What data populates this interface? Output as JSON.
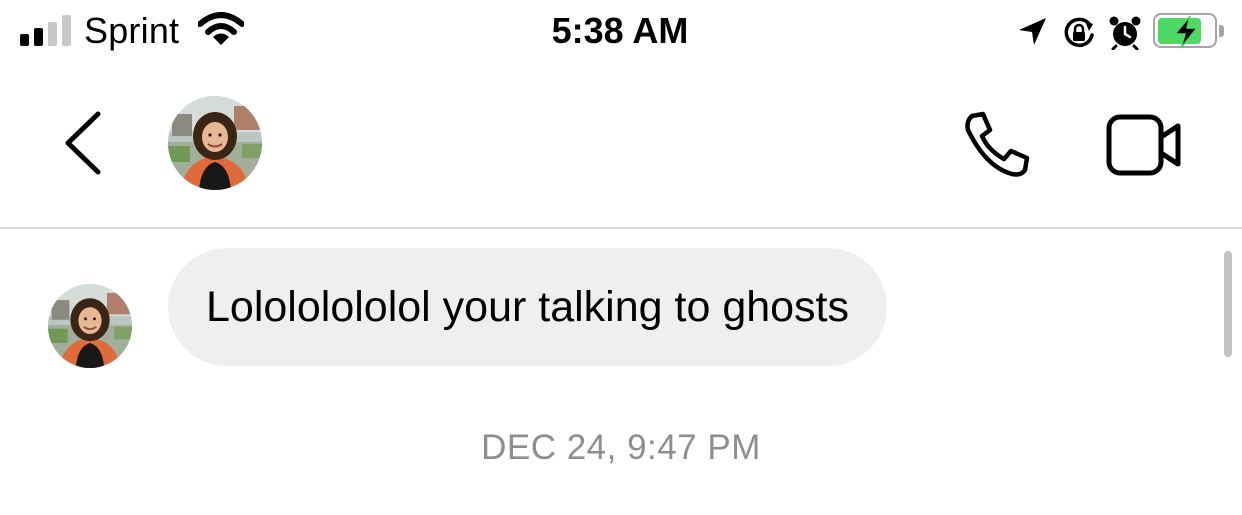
{
  "status_bar": {
    "carrier": "Sprint",
    "time": "5:38 AM",
    "signal_bars_active": 2,
    "signal_bars_total": 4,
    "battery_level": 0.85,
    "battery_charging": true,
    "icons": [
      "cellular-signal-icon",
      "wifi-icon",
      "location-arrow-icon",
      "rotation-lock-icon",
      "alarm-icon",
      "battery-charging-icon"
    ]
  },
  "header": {
    "back_icon": "chevron-left-icon",
    "call_icon": "phone-icon",
    "video_icon": "video-camera-icon"
  },
  "messages": [
    {
      "direction": "incoming",
      "text": "Lolololololol your talking to ghosts"
    }
  ],
  "timestamp": "DEC 24, 9:47 PM",
  "colors": {
    "bubble_background": "#efefef",
    "timestamp_text": "#8e8e8e",
    "divider": "#dbdbdb",
    "battery_fill": "#4cd964",
    "signal_inactive": "#c7c7cc"
  }
}
